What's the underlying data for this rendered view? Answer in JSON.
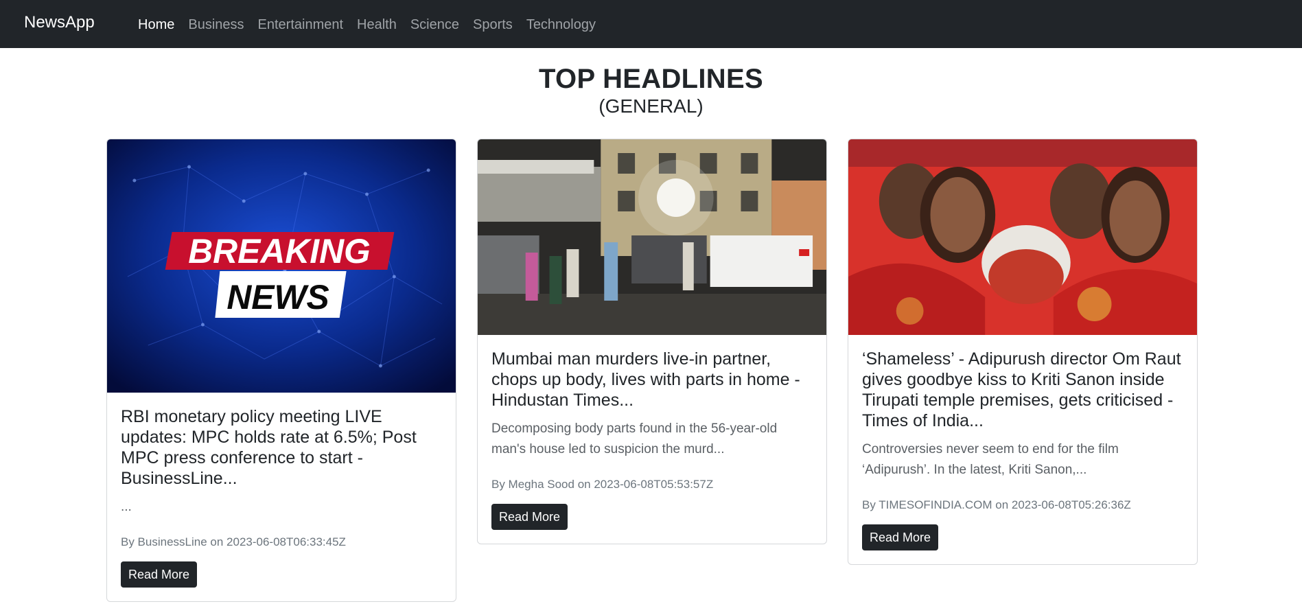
{
  "navbar": {
    "brand": "NewsApp",
    "links": [
      "Home",
      "Business",
      "Entertainment",
      "Health",
      "Science",
      "Sports",
      "Technology"
    ],
    "active": "Home"
  },
  "heading": {
    "title": "TOP HEADLINES",
    "subtitle": "(GENERAL)"
  },
  "cards": [
    {
      "image_text_line1": "BREAKING",
      "image_text_line2": "NEWS",
      "title": "RBI monetary policy meeting LIVE updates: MPC holds rate at 6.5%; Post MPC press conference to start - BusinessLine...",
      "description": "...",
      "byline": "By BusinessLine on 2023-06-08T06:33:45Z",
      "button": "Read More"
    },
    {
      "title": "Mumbai man murders live-in partner, chops up body, lives with parts in home - Hindustan Times...",
      "description": "Decomposing body parts found in the 56-year-old man's house led to suspicion the murd...",
      "byline": "By Megha Sood on 2023-06-08T05:53:57Z",
      "button": "Read More"
    },
    {
      "title": "‘Shameless’ - Adipurush director Om Raut gives goodbye kiss to Kriti Sanon inside Tirupati temple premises, gets criticised - Times of India...",
      "description": "Controversies never seem to end for the film ‘Adipurush’. In the latest, Kriti Sanon,...",
      "byline": "By TIMESOFINDIA.COM on 2023-06-08T05:26:36Z",
      "button": "Read More"
    }
  ]
}
